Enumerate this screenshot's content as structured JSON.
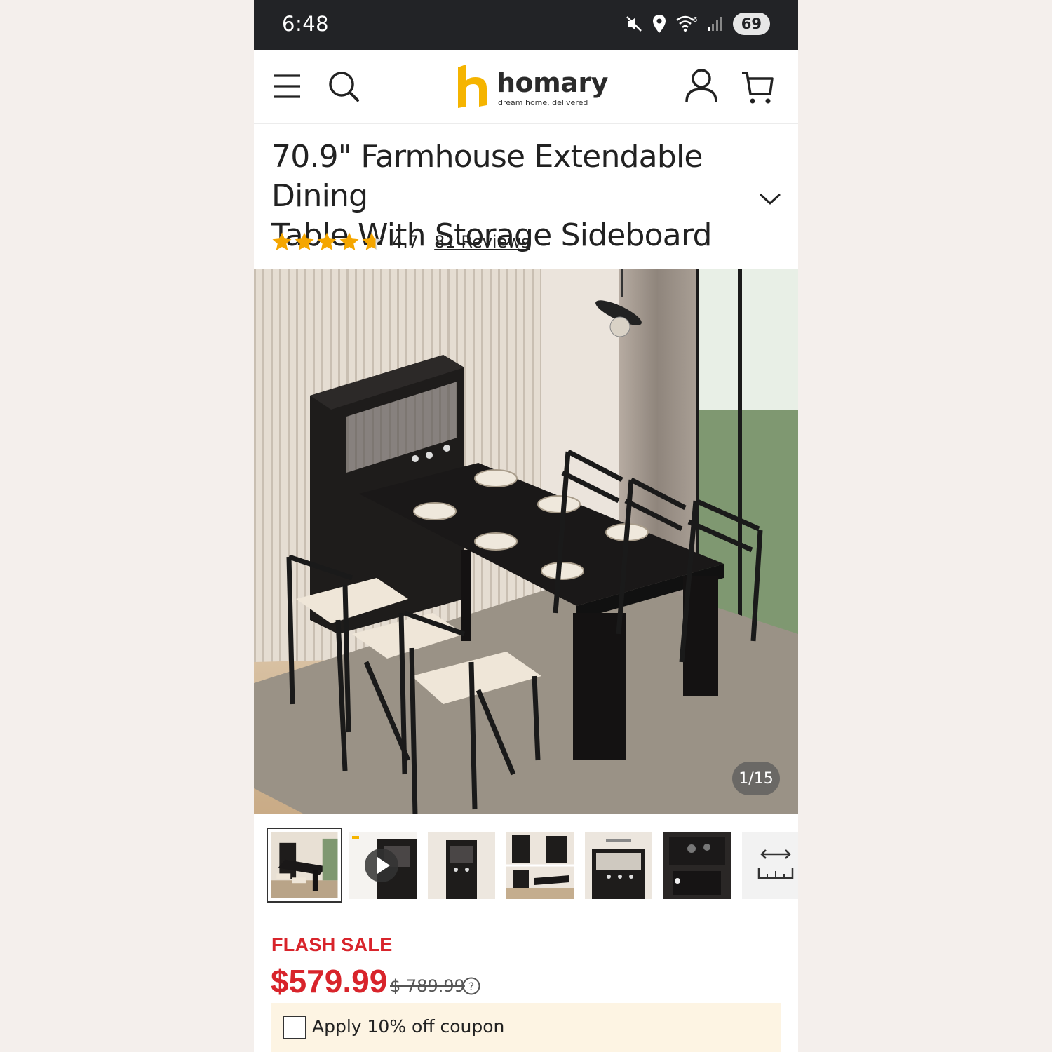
{
  "status_bar": {
    "time": "6:48",
    "battery": "69",
    "icons": [
      "mute-icon",
      "location-icon",
      "wifi-6-icon",
      "signal-icon",
      "battery-icon"
    ]
  },
  "header": {
    "brand": "homary",
    "tagline": "dream home, delivered",
    "icons": [
      "menu-icon",
      "search-icon",
      "account-icon",
      "cart-icon"
    ],
    "logo_color": "#f5b400"
  },
  "product": {
    "title_line1": "70.9\" Farmhouse Extendable Dining",
    "title_line2": "Table With Storage Sideboard",
    "rating": "4.7",
    "rating_stars": 4.7,
    "reviews_label": "81 Reviews"
  },
  "gallery": {
    "counter": "1/15",
    "thumbnail_count": 7,
    "active_index": 0
  },
  "pricing": {
    "flash_label": "FLASH SALE",
    "price": "$579.99",
    "old_price": "$ 789.99",
    "accent_color": "#d8242b"
  },
  "coupon": {
    "label": "Apply 10% off coupon",
    "checked": false
  }
}
